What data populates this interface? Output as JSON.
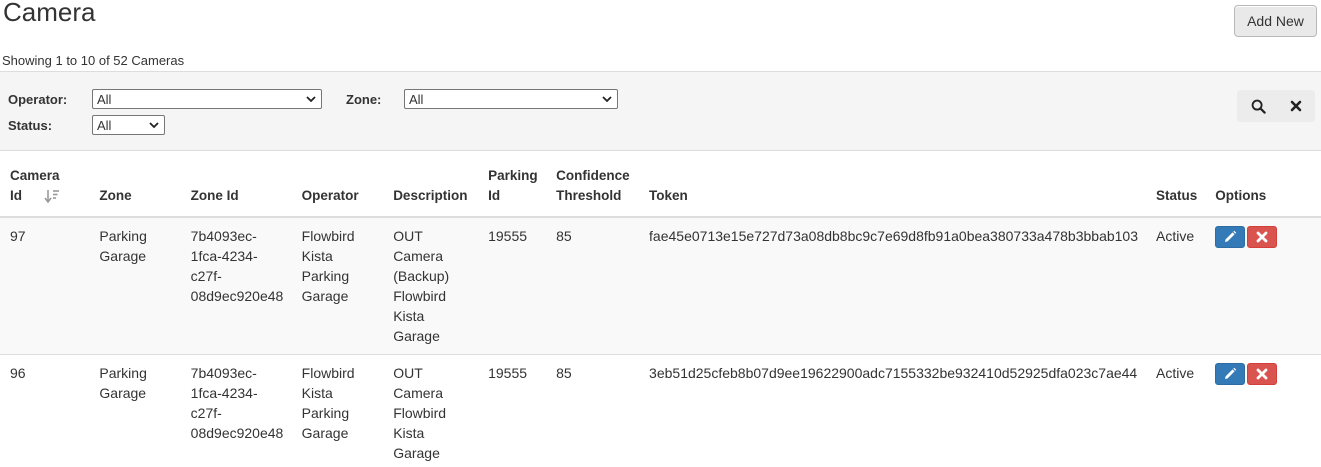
{
  "page": {
    "title": "Camera",
    "add_button": "Add New",
    "showing": "Showing 1 to 10 of 52 Cameras"
  },
  "filters": {
    "operator_label": "Operator:",
    "operator_value": "All",
    "zone_label": "Zone:",
    "zone_value": "All",
    "status_label": "Status:",
    "status_value": "All"
  },
  "icons": {
    "search": "search-icon",
    "clear": "close-icon",
    "sort": "sort-icon",
    "edit": "pencil-icon",
    "delete": "delete-icon"
  },
  "colors": {
    "edit": "#337ab7",
    "delete": "#d9534f"
  },
  "table": {
    "headers": {
      "camera_id_1": "Camera",
      "camera_id_2": "Id",
      "zone": "Zone",
      "zone_id": "Zone Id",
      "operator": "Operator",
      "description": "Description",
      "parking_id_1": "Parking",
      "parking_id_2": "Id",
      "confidence_1": "Confidence",
      "confidence_2": "Threshold",
      "token": "Token",
      "status": "Status",
      "options": "Options"
    },
    "rows": [
      {
        "camera_id": "97",
        "zone": [
          "Parking",
          "Garage"
        ],
        "zone_id": [
          "7b4093ec-",
          "1fca-4234-",
          "c27f-",
          "08d9ec920e48"
        ],
        "operator": [
          "Flowbird",
          "Kista",
          "Parking",
          "Garage"
        ],
        "description": [
          "OUT",
          "Camera",
          "(Backup)",
          "Flowbird",
          "Kista",
          "Garage"
        ],
        "parking_id": "19555",
        "confidence": "85",
        "token": "fae45e0713e15e727d73a08db8bc9c7e69d8fb91a0bea380733a478b3bbab103",
        "status": "Active"
      },
      {
        "camera_id": "96",
        "zone": [
          "Parking",
          "Garage"
        ],
        "zone_id": [
          "7b4093ec-",
          "1fca-4234-",
          "c27f-",
          "08d9ec920e48"
        ],
        "operator": [
          "Flowbird",
          "Kista",
          "Parking",
          "Garage"
        ],
        "description": [
          "OUT",
          "Camera",
          "Flowbird",
          "Kista",
          "Garage"
        ],
        "parking_id": "19555",
        "confidence": "85",
        "token": "3eb51d25cfeb8b07d9ee19622900adc7155332be932410d52925dfa023c7ae44",
        "status": "Active"
      }
    ]
  }
}
